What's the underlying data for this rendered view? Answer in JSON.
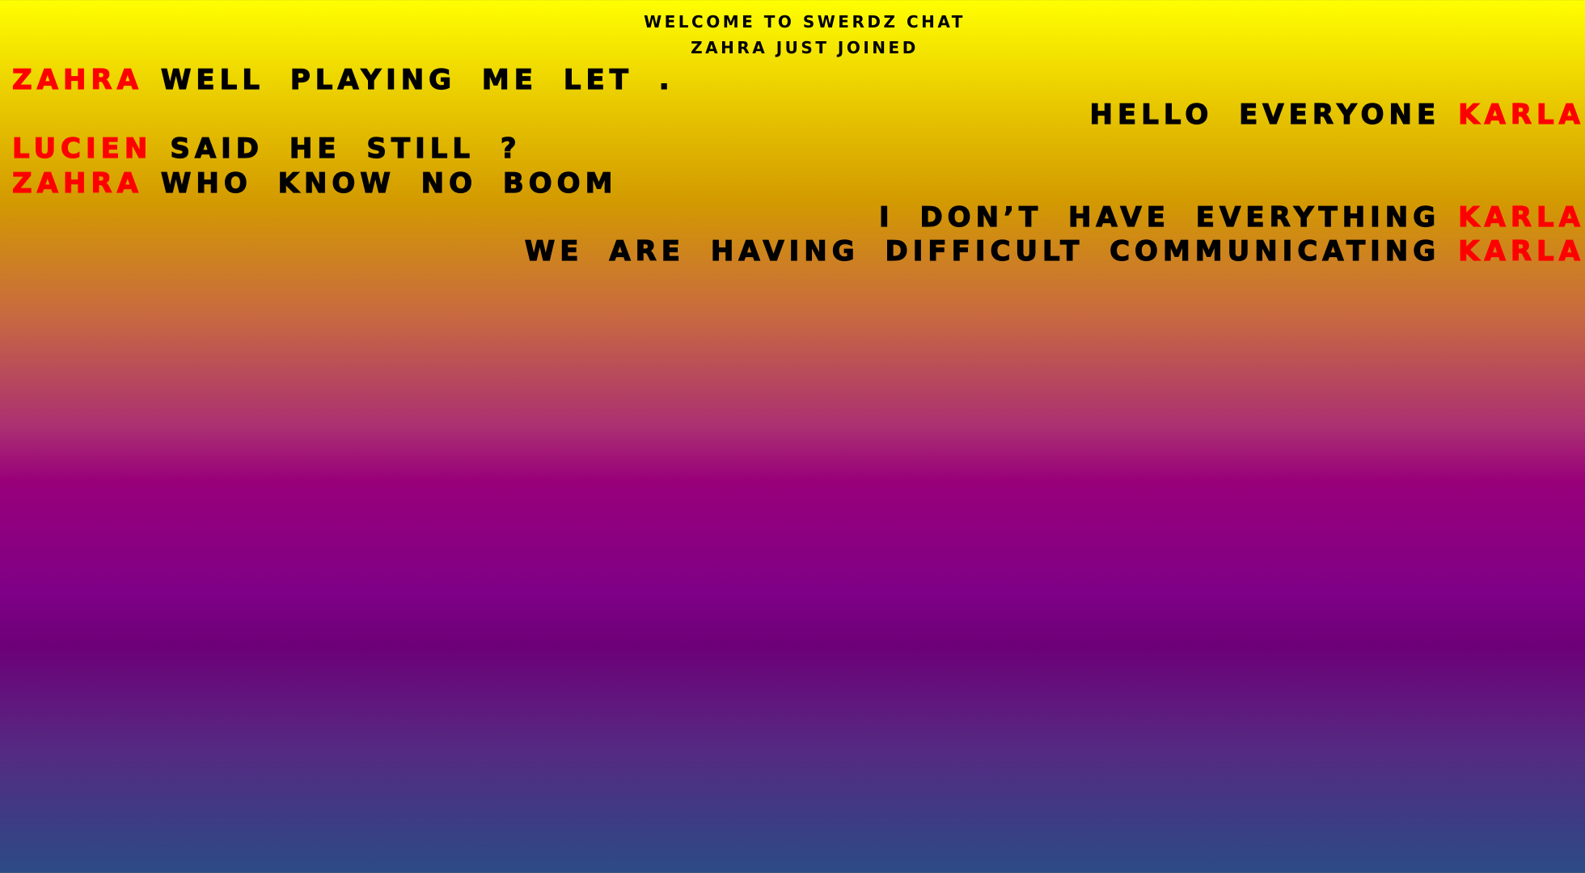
{
  "chat": {
    "welcome": "WELCOME TO SWERDZ CHAT",
    "join_notice": "ZAHRA JUST JOINED",
    "messages": [
      {
        "user": "ZAHRA",
        "text": "WELL PLAYING ME LET .",
        "align": "left"
      },
      {
        "user": "KARLA",
        "text": "HELLO EVERYONE",
        "align": "right"
      },
      {
        "user": "LUCIEN",
        "text": "SAID HE STILL ?",
        "align": "left"
      },
      {
        "user": "ZAHRA",
        "text": "WHO KNOW NO BOOM",
        "align": "left"
      },
      {
        "user": "KARLA",
        "text": "I DON’T HAVE EVERYTHING",
        "align": "right"
      },
      {
        "user": "KARLA",
        "text": "WE ARE HAVING DIFFICULT COMMUNICATING",
        "align": "right"
      }
    ]
  },
  "colors": {
    "username": "#ff0000",
    "message_text": "#000000",
    "background_top": "#ffff00",
    "background_bottom": "#2c4b86"
  }
}
